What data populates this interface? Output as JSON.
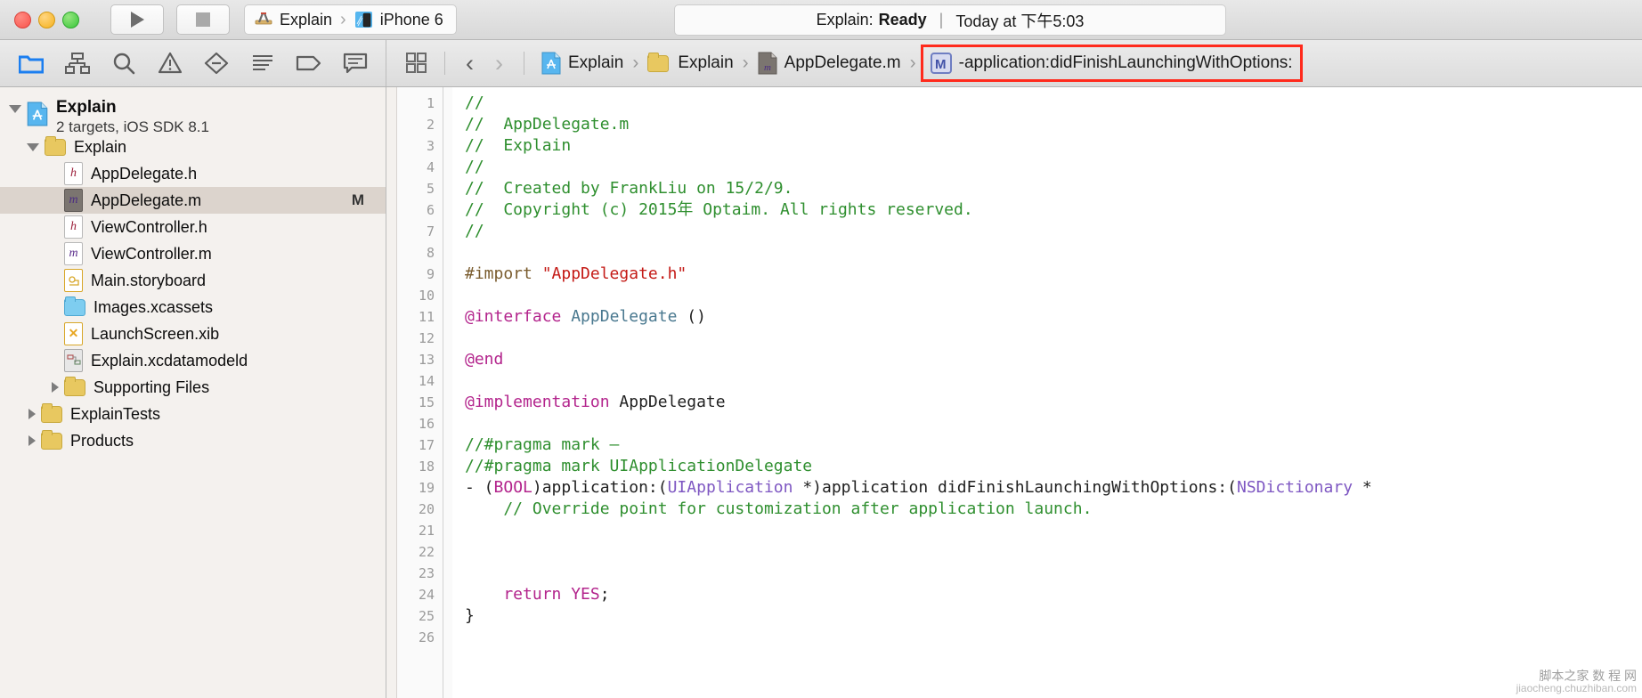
{
  "window": {
    "traffic_lights": [
      "close-red",
      "minimize-amber",
      "zoom-green"
    ],
    "run_button_label": "Run",
    "stop_button_label": "Stop",
    "scheme": {
      "project": "Explain",
      "separator": "›",
      "destination": "iPhone 6",
      "project_icon": "xcode-project-icon",
      "destination_icon": "iphone-simulator-icon"
    },
    "status": {
      "prefix": "Explain:",
      "state": "Ready",
      "divider": "|",
      "timestamp": "Today at 下午5:03"
    }
  },
  "toolbar": {
    "icons": [
      {
        "name": "navigator-folder-icon",
        "label": "Project navigator",
        "active": true
      },
      {
        "name": "symbol-hierarchy-icon",
        "label": "Symbol navigator",
        "active": false
      },
      {
        "name": "search-icon",
        "label": "Find navigator",
        "active": false
      },
      {
        "name": "warning-triangle-icon",
        "label": "Issue navigator",
        "active": false
      },
      {
        "name": "test-diamond-icon",
        "label": "Test navigator",
        "active": false
      },
      {
        "name": "debug-list-icon",
        "label": "Debug navigator",
        "active": false
      },
      {
        "name": "breakpoint-tag-icon",
        "label": "Breakpoint navigator",
        "active": false
      },
      {
        "name": "report-comment-icon",
        "label": "Report navigator",
        "active": false
      }
    ],
    "related_items_icon": "related-items-icon",
    "back_chevron": "‹",
    "forward_chevron": "›"
  },
  "breadcrumb": {
    "items": [
      {
        "label": "Explain",
        "icon": "xcode-project-file-icon",
        "highlighted": false
      },
      {
        "label": "Explain",
        "icon": "yellow-folder-icon",
        "highlighted": false
      },
      {
        "label": "AppDelegate.m",
        "icon": "objc-m-file-icon",
        "highlighted": false
      },
      {
        "label": "-application:didFinishLaunchingWithOptions:",
        "icon": "method-m-badge-icon",
        "highlighted": true
      }
    ],
    "separator": "›",
    "highlight_color": "#ff2a1c"
  },
  "navigator": {
    "project": {
      "name": "Explain",
      "subtitle": "2 targets, iOS SDK 8.1",
      "icon": "xcode-project-file-icon",
      "expanded": true
    },
    "items": [
      {
        "label": "Explain",
        "icon": "yellow-folder-icon",
        "indent": 1,
        "disclosure": "open",
        "selected": false,
        "badge": ""
      },
      {
        "label": "AppDelegate.h",
        "icon": "header-h-file-icon",
        "indent": 2,
        "disclosure": "none",
        "selected": false,
        "badge": ""
      },
      {
        "label": "AppDelegate.m",
        "icon": "objc-m-file-icon",
        "indent": 2,
        "disclosure": "none",
        "selected": true,
        "badge": "M"
      },
      {
        "label": "ViewController.h",
        "icon": "header-h-file-icon",
        "indent": 2,
        "disclosure": "none",
        "selected": false,
        "badge": ""
      },
      {
        "label": "ViewController.m",
        "icon": "objc-m-file-icon",
        "indent": 2,
        "disclosure": "none",
        "selected": false,
        "badge": ""
      },
      {
        "label": "Main.storyboard",
        "icon": "storyboard-file-icon",
        "indent": 2,
        "disclosure": "none",
        "selected": false,
        "badge": ""
      },
      {
        "label": "Images.xcassets",
        "icon": "asset-catalog-icon",
        "indent": 2,
        "disclosure": "none",
        "selected": false,
        "badge": ""
      },
      {
        "label": "LaunchScreen.xib",
        "icon": "xib-file-icon",
        "indent": 2,
        "disclosure": "none",
        "selected": false,
        "badge": ""
      },
      {
        "label": "Explain.xcdatamodeld",
        "icon": "xcdatamodel-file-icon",
        "indent": 2,
        "disclosure": "none",
        "selected": false,
        "badge": ""
      },
      {
        "label": "Supporting Files",
        "icon": "yellow-folder-icon",
        "indent": 2,
        "disclosure": "closed",
        "selected": false,
        "badge": ""
      },
      {
        "label": "ExplainTests",
        "icon": "yellow-folder-icon",
        "indent": 1,
        "disclosure": "closed",
        "selected": false,
        "badge": ""
      },
      {
        "label": "Products",
        "icon": "yellow-folder-icon",
        "indent": 1,
        "disclosure": "closed",
        "selected": false,
        "badge": ""
      }
    ]
  },
  "editor": {
    "filename": "AppDelegate.m",
    "modified_badge": "M",
    "line_numbers": [
      "1",
      "2",
      "3",
      "4",
      "5",
      "6",
      "7",
      "8",
      "9",
      "10",
      "11",
      "12",
      "13",
      "14",
      "15",
      "16",
      "17",
      "18",
      "19",
      "20",
      "21",
      "22",
      "23",
      "24",
      "25",
      "26"
    ],
    "lines": [
      {
        "n": "1",
        "tokens": [
          {
            "t": "//",
            "c": "cm"
          }
        ]
      },
      {
        "n": "2",
        "tokens": [
          {
            "t": "//  AppDelegate.m",
            "c": "cm"
          }
        ]
      },
      {
        "n": "3",
        "tokens": [
          {
            "t": "//  Explain",
            "c": "cm"
          }
        ]
      },
      {
        "n": "4",
        "tokens": [
          {
            "t": "//",
            "c": "cm"
          }
        ]
      },
      {
        "n": "5",
        "tokens": [
          {
            "t": "//  Created by FrankLiu on 15/2/9.",
            "c": "cm"
          }
        ]
      },
      {
        "n": "6",
        "tokens": [
          {
            "t": "//  Copyright (c) 2015年 Optaim. All rights reserved.",
            "c": "cm"
          }
        ]
      },
      {
        "n": "7",
        "tokens": [
          {
            "t": "//",
            "c": "cm"
          }
        ]
      },
      {
        "n": "8",
        "tokens": []
      },
      {
        "n": "9",
        "tokens": [
          {
            "t": "#import ",
            "c": "pre"
          },
          {
            "t": "\"AppDelegate.h\"",
            "c": "str"
          }
        ]
      },
      {
        "n": "10",
        "tokens": []
      },
      {
        "n": "11",
        "tokens": [
          {
            "t": "@interface ",
            "c": "kw"
          },
          {
            "t": "AppDelegate",
            "c": "typ"
          },
          {
            "t": " ()",
            "c": ""
          }
        ]
      },
      {
        "n": "12",
        "tokens": []
      },
      {
        "n": "13",
        "tokens": [
          {
            "t": "@end",
            "c": "kw"
          }
        ]
      },
      {
        "n": "14",
        "tokens": []
      },
      {
        "n": "15",
        "tokens": [
          {
            "t": "@implementation ",
            "c": "kw"
          },
          {
            "t": "AppDelegate",
            "c": ""
          }
        ]
      },
      {
        "n": "16",
        "tokens": []
      },
      {
        "n": "17",
        "tokens": [
          {
            "t": "//#pragma mark –",
            "c": "cm"
          }
        ]
      },
      {
        "n": "18",
        "tokens": [
          {
            "t": "//#pragma mark UIApplicationDelegate",
            "c": "cm"
          }
        ]
      },
      {
        "n": "19",
        "tokens": [
          {
            "t": "- (",
            "c": ""
          },
          {
            "t": "BOOL",
            "c": "kw"
          },
          {
            "t": ")application:(",
            "c": ""
          },
          {
            "t": "UIApplication",
            "c": "typ2"
          },
          {
            "t": " *)application didFinishLaunchingWithOptions:(",
            "c": ""
          },
          {
            "t": "NSDictionary",
            "c": "typ2"
          },
          {
            "t": " *",
            "c": ""
          }
        ]
      },
      {
        "n": "20",
        "tokens": [
          {
            "t": "    // Override point for customization after application launch.",
            "c": "cm"
          }
        ]
      },
      {
        "n": "21",
        "tokens": []
      },
      {
        "n": "22",
        "tokens": []
      },
      {
        "n": "23",
        "tokens": []
      },
      {
        "n": "24",
        "tokens": [
          {
            "t": "    return ",
            "c": "kw"
          },
          {
            "t": "YES",
            "c": "kw"
          },
          {
            "t": ";",
            "c": ""
          }
        ]
      },
      {
        "n": "25",
        "tokens": [
          {
            "t": "}",
            "c": ""
          }
        ]
      },
      {
        "n": "26",
        "tokens": []
      }
    ]
  },
  "watermark": {
    "line1": "脚本之家 数 程 网",
    "line2": "jiaocheng.chuzhiban.com"
  },
  "colors": {
    "accent_blue": "#1b7ef0",
    "highlight_red": "#ff2a1c",
    "comment_green": "#2f8f2f",
    "keyword_magenta": "#b3248c",
    "string_red": "#c41a16",
    "selection_tan": "#dcd4cd",
    "sidebar_bg": "#f4f1ee"
  }
}
